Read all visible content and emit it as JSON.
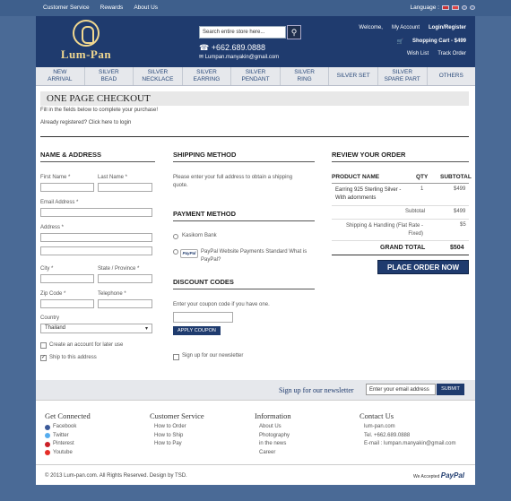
{
  "topbar": {
    "links": [
      "Customer Service",
      "Rewards",
      "About Us"
    ],
    "language_label": "Language :"
  },
  "header": {
    "logo_text": "Lum-Pan",
    "search_placeholder": "Search entire store here...",
    "phone": "+662.689.0888",
    "email": "Lumpan.manyakin@gmail.com",
    "welcome": "Welcome,",
    "my_account": "My Account",
    "login_register": "Login/Register",
    "cart": "Shopping Cart - $499",
    "wish_list": "Wish List",
    "track_order": "Track Order"
  },
  "nav": [
    [
      "NEW",
      "ARRIVAL"
    ],
    [
      "SILVER",
      "BEAD"
    ],
    [
      "SILVER",
      "NECKLACE"
    ],
    [
      "SILVER",
      "EARRING"
    ],
    [
      "SILVER",
      "PENDANT"
    ],
    [
      "SILVER",
      "RING"
    ],
    [
      "SILVER SET"
    ],
    [
      "SILVER",
      "SPARE PART"
    ],
    [
      "OTHERS"
    ]
  ],
  "checkout": {
    "title": "ONE PAGE CHECKOUT",
    "intro": "Fill in the fields below to complete your purchase!",
    "registered": "Already registered? Click here to login"
  },
  "name_address": {
    "title": "NAME & ADDRESS",
    "first_name": "First Name *",
    "last_name": "Last Name *",
    "email": "Email Address *",
    "address": "Address *",
    "city": "City *",
    "state": "State / Province *",
    "zip": "Zip Code *",
    "telephone": "Telephone *",
    "country_label": "Country",
    "country_value": "Thailand",
    "create_account": "Create an account for later use",
    "ship_to_address": "Ship to this address"
  },
  "shipping": {
    "title": "SHIPPING METHOD",
    "note": "Please enter your full address to obtain a shipping quote."
  },
  "payment": {
    "title": "PAYMENT METHOD",
    "option1": "Kasikorn Bank",
    "option2": "PayPal Website Payments Standard",
    "option2_link": "What is PayPal?",
    "paypal_badge": "PayPal"
  },
  "discount": {
    "title": "DISCOUNT CODES",
    "note": "Enter your coupon code if you have one.",
    "button": "APPLY COUPON",
    "newsletter": "Sign up for our newsletter"
  },
  "review": {
    "title": "REVIEW YOUR ORDER",
    "col_product": "PRODUCT NAME",
    "col_qty": "QTY",
    "col_subtotal": "SUBTOTAL",
    "product": "Earring 925 Sterling Silver - With adornments",
    "qty": "1",
    "price": "$499",
    "subtotal_label": "Subtotal",
    "subtotal_value": "$499",
    "shipping_label": "Shipping & Handling (Flat Rate - Fixed)",
    "shipping_value": "$5",
    "grand_label": "GRAND TOTAL",
    "grand_value": "$504",
    "place_order": "PLACE ORDER NOW"
  },
  "newsletter_bar": {
    "label": "Sign up for our newsletter",
    "placeholder": "Enter your email address",
    "button": "SUBMIT"
  },
  "footer": {
    "connected_title": "Get Connected",
    "social": [
      "Facebook",
      "Twitter",
      "Pinterest",
      "Youtube"
    ],
    "service_title": "Customer Service",
    "service_links": [
      "How to Order",
      "How to Ship",
      "How to Pay"
    ],
    "info_title": "Information",
    "info_links": [
      "About Us",
      "Photography",
      "in the news",
      "Career"
    ],
    "contact_title": "Contact Us",
    "contact_lines": [
      "lum-pan.com",
      "Tel. +662.689.0888",
      "E-mail : lumpan.manyakin@gmail.com"
    ],
    "copyright": "© 2013 Lum-pan.com. All Rights Reserved.   Design by TSD.",
    "we_accept": "We Accepted",
    "paypal": "PayPal"
  },
  "colors": {
    "brand": "#1f3b6e",
    "background": "#4a6a96",
    "gold": "#f1d890"
  }
}
